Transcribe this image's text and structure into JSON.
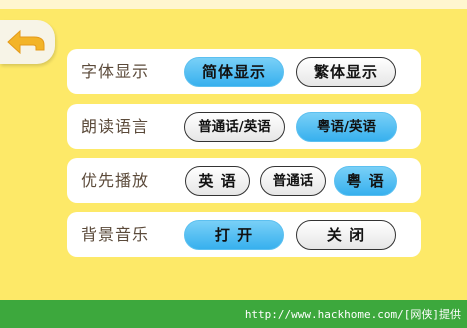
{
  "header": {
    "back_icon": "back-arrow-icon"
  },
  "colors": {
    "background": "#fde968",
    "selected": "#37b0ee",
    "bottom_bar": "#3da83d"
  },
  "settings": {
    "font_display": {
      "label": "字体显示",
      "options": [
        "简体显示",
        "繁体显示"
      ],
      "selected": "简体显示"
    },
    "reading_language": {
      "label": "朗读语言",
      "options": [
        "普通话/英语",
        "粤语/英语"
      ],
      "selected": "粤语/英语"
    },
    "priority_playback": {
      "label": "优先播放",
      "options": [
        "英 语",
        "普通话",
        "粤 语"
      ],
      "selected": "粤 语"
    },
    "background_music": {
      "label": "背景音乐",
      "options": [
        "打 开",
        "关 闭"
      ],
      "selected": "打 开"
    }
  },
  "footer": {
    "watermark": "http://www.hackhome.com/[网侠]提供"
  }
}
